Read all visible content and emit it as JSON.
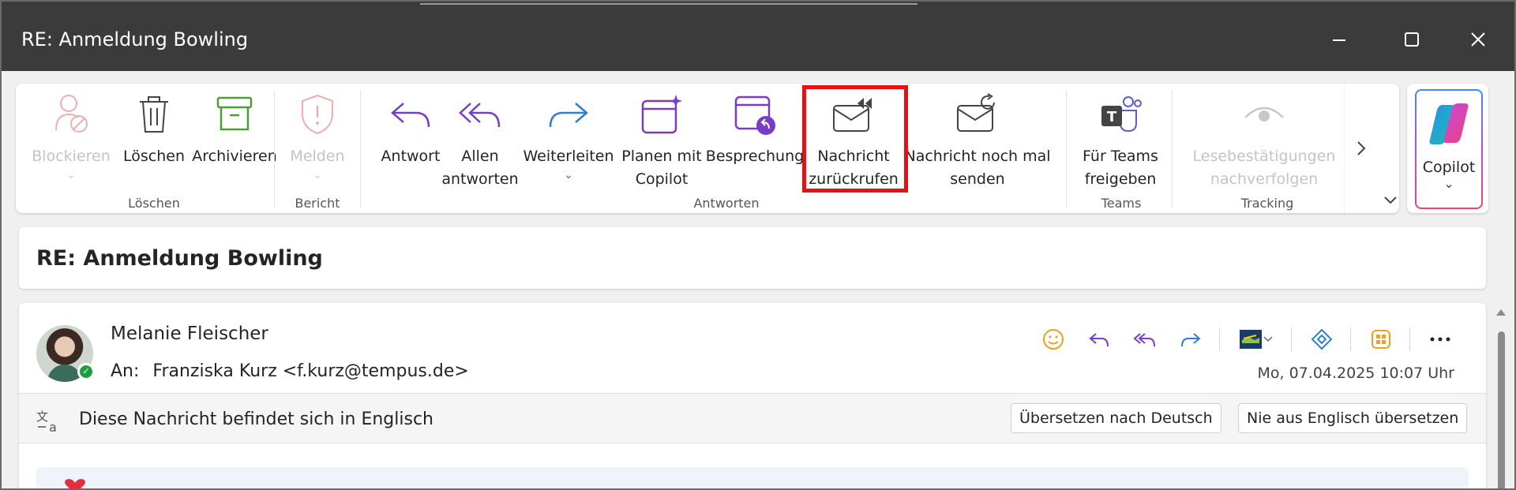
{
  "window": {
    "title": "RE: Anmeldung Bowling",
    "controls": [
      "minimize-icon",
      "maximize-icon",
      "close-icon"
    ]
  },
  "ribbon": {
    "groups": [
      {
        "label": "Löschen",
        "buttons": [
          {
            "label": "Blockieren",
            "icon": "block-user-icon",
            "disabled": true,
            "has_dropdown": true
          },
          {
            "label": "Löschen",
            "icon": "trash-icon",
            "disabled": false
          },
          {
            "label": "Archivieren",
            "icon": "archive-icon",
            "disabled": false
          }
        ]
      },
      {
        "label": "Bericht",
        "buttons": [
          {
            "label": "Melden",
            "icon": "shield-alert-icon",
            "disabled": true,
            "has_dropdown": true
          }
        ]
      },
      {
        "label": "Antworten",
        "buttons": [
          {
            "label": "Antwort",
            "icon": "reply-icon"
          },
          {
            "label_lines": [
              "Allen",
              "antworten"
            ],
            "icon": "reply-all-icon"
          },
          {
            "label": "Weiterleiten",
            "icon": "forward-icon",
            "has_dropdown": true
          },
          {
            "label_lines": [
              "Planen mit",
              "Copilot"
            ],
            "icon": "calendar-sparkle-icon"
          },
          {
            "label": "Besprechung",
            "icon": "calendar-reply-icon"
          },
          {
            "label_lines": [
              "Nachricht",
              "zurückrufen"
            ],
            "icon": "recall-mail-icon",
            "highlighted": true
          },
          {
            "label_lines": [
              "Nachricht noch mal",
              "senden"
            ],
            "icon": "resend-mail-icon"
          }
        ]
      },
      {
        "label": "Teams",
        "buttons": [
          {
            "label_lines": [
              "Für Teams",
              "freigeben"
            ],
            "icon": "teams-icon"
          }
        ]
      },
      {
        "label": "Tracking",
        "buttons": [
          {
            "label_lines": [
              "Lesebestätigungen",
              "nachverfolgen"
            ],
            "icon": "eye-icon",
            "disabled": true
          }
        ]
      }
    ],
    "copilot": {
      "label": "Copilot",
      "icon": "copilot-icon"
    }
  },
  "message": {
    "subject": "RE: Anmeldung Bowling",
    "sender": "Melanie Fleischer",
    "to_label": "An:",
    "to": "Franziska Kurz <f.kurz@tempus.de>",
    "datetime": "Mo, 07.04.2025 10:07 Uhr",
    "presence": "available",
    "actions": [
      "emoji-icon",
      "reply-icon",
      "reply-all-icon",
      "forward-icon",
      "app-icon",
      "loop-icon",
      "apps-icon",
      "more-icon"
    ]
  },
  "translation": {
    "text": "Diese Nachricht befindet sich in Englisch",
    "translate_button": "Übersetzen nach Deutsch",
    "never_button": "Nie aus Englisch übersetzen"
  },
  "colors": {
    "titlebar": "#3b3b3b",
    "accent_purple": "#7a3cc6",
    "accent_blue": "#2d7fd3",
    "highlight": "#e81010",
    "archive_green": "#4f9c3a"
  }
}
